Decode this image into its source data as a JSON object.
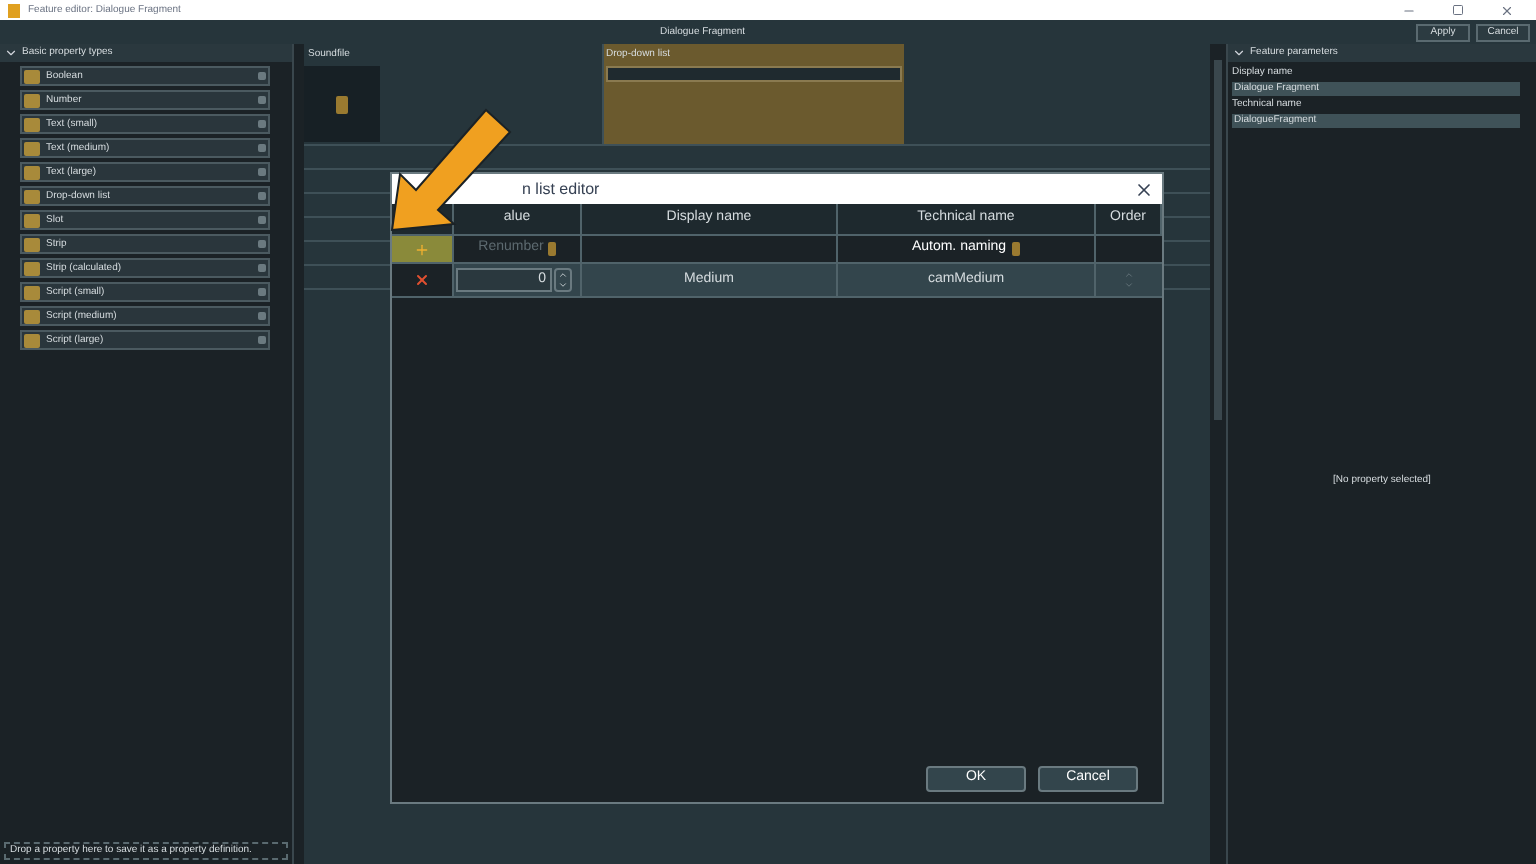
{
  "window": {
    "title": "Feature editor: Dialogue Fragment"
  },
  "toolbar": {
    "title": "Dialogue Fragment",
    "buttons": [
      "Apply",
      "Cancel"
    ]
  },
  "left_panel": {
    "header": "Basic property types",
    "expanded": true,
    "items": [
      {
        "label": "Boolean"
      },
      {
        "label": "Number"
      },
      {
        "label": "Text (small)"
      },
      {
        "label": "Text (medium)"
      },
      {
        "label": "Text (large)"
      },
      {
        "label": "Drop-down list"
      },
      {
        "label": "Slot"
      },
      {
        "label": "Strip"
      },
      {
        "label": "Strip (calculated)"
      },
      {
        "label": "Script (small)"
      },
      {
        "label": "Script (medium)"
      },
      {
        "label": "Script (large)"
      }
    ],
    "drop_hint": "Drop a property here to save it as a property definition."
  },
  "canvas": {
    "fields": [
      {
        "label": "Soundfile",
        "kind": "asset",
        "selected": false
      },
      {
        "label": "Drop-down list",
        "kind": "dropdown",
        "selected": true
      }
    ]
  },
  "dialog": {
    "title": "n list editor",
    "columns": [
      "alue",
      "Display name",
      "Technical name",
      "Order"
    ],
    "renumber": {
      "label": "Renumber",
      "disabled": true
    },
    "auto_naming": "Autom. naming",
    "rows": [
      {
        "value": "0",
        "display_name": "Medium",
        "technical_name": "camMedium"
      }
    ],
    "buttons": [
      "OK",
      "Cancel"
    ]
  },
  "right_panel": {
    "header": "Feature parameters",
    "expanded": true,
    "fields": [
      {
        "label": "Display name",
        "value": "Dialogue Fragment"
      },
      {
        "label": "Technical name",
        "value": "DialogueFragment"
      }
    ],
    "empty_text": "[No property selected]"
  }
}
